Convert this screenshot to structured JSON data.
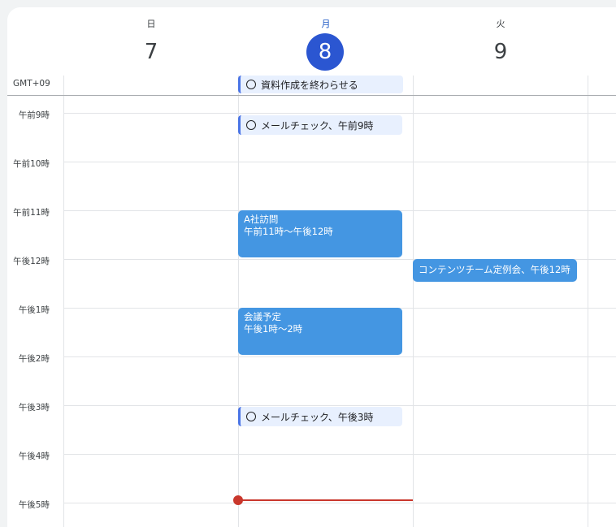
{
  "days": [
    {
      "name": "日",
      "number": "7",
      "today": false
    },
    {
      "name": "月",
      "number": "8",
      "today": true
    },
    {
      "name": "火",
      "number": "9",
      "today": false
    }
  ],
  "timezone": "GMT+09",
  "time_labels": [
    "午前9時",
    "午前10時",
    "午前11時",
    "午後12時",
    "午後1時",
    "午後2時",
    "午後3時",
    "午後4時",
    "午後5時"
  ],
  "tasks": [
    {
      "label": "資料作成を終わらせる"
    },
    {
      "label": "メールチェック、午前9時"
    },
    {
      "label": "メールチェック、午後3時"
    }
  ],
  "events": [
    {
      "title": "A社訪問",
      "time": "午前11時～午後12時"
    },
    {
      "title": "コンテンツチーム定例会、午後12時",
      "time": ""
    },
    {
      "title": "会議予定",
      "time": "午後1時～2時"
    }
  ],
  "colors": {
    "today_accent": "#2b56d1",
    "event_blue": "#4496e2",
    "task_bg": "#e8f0fe",
    "now_indicator": "#c9372c"
  }
}
